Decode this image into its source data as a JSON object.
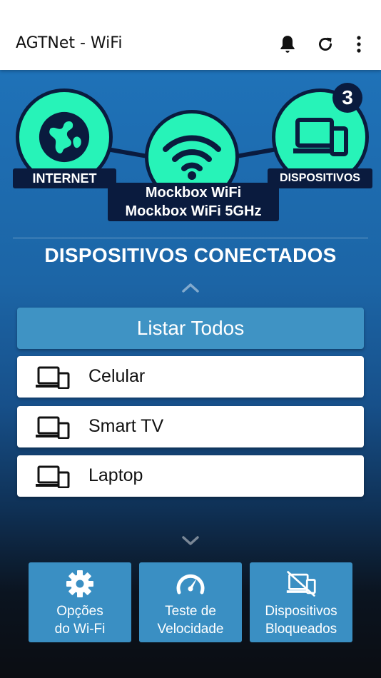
{
  "appbar": {
    "title": "AGTNet - WiFi",
    "actions": [
      {
        "icon": "bell-icon"
      },
      {
        "icon": "refresh-icon"
      },
      {
        "icon": "more-vert-icon"
      }
    ]
  },
  "network": {
    "internet_label": "INTERNET",
    "devices_label": "DISPOSITIVOS",
    "devices_count": "3",
    "wifi_names": [
      "Mockbox WiFi",
      "Mockbox WiFi 5GHz"
    ]
  },
  "section": {
    "title": "DISPOSITIVOS CONECTADOS",
    "list_all_label": "Listar Todos"
  },
  "devices": [
    {
      "name": "Celular",
      "icon": "devices-icon"
    },
    {
      "name": "Smart TV",
      "icon": "devices-icon"
    },
    {
      "name": "Laptop",
      "icon": "devices-icon"
    }
  ],
  "actions": [
    {
      "line1": "Opções",
      "line2": "do Wi-Fi",
      "icon": "gear-icon"
    },
    {
      "line1": "Teste de",
      "line2": "Velocidade",
      "icon": "speedometer-icon"
    },
    {
      "line1": "Dispositivos",
      "line2": "Bloqueados",
      "icon": "devices-blocked-icon"
    }
  ],
  "colors": {
    "accent_green": "#27f3b8",
    "navy": "#0a1b3e",
    "button_blue": "#3f93c4"
  }
}
